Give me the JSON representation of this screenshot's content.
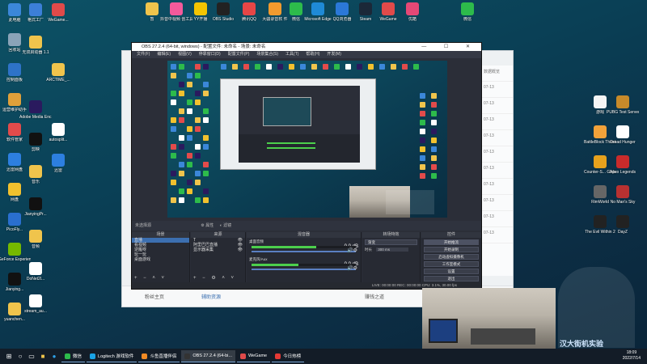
{
  "desktop": {
    "left_icons": [
      {
        "label": "此电脑",
        "icon": "computer-icon",
        "color": "#3b87d9"
      },
      {
        "label": "回收站",
        "icon": "recycle-bin-icon",
        "color": "#8aa3b8"
      },
      {
        "label": "控制面板",
        "icon": "control-panel-icon",
        "color": "#2e73c8"
      },
      {
        "label": "运营维护助手",
        "icon": "maintenance-icon",
        "color": "#e0a03a"
      },
      {
        "label": "软件管家",
        "icon": "software-manager-icon",
        "color": "#e24b4b"
      },
      {
        "label": "迅雷网盘",
        "icon": "thunder-drive-icon",
        "color": "#2d7fe0"
      },
      {
        "label": "网盘",
        "icon": "netdisk-icon",
        "color": "#f2c12e"
      },
      {
        "label": "PicoFly...",
        "icon": "picofly-icon",
        "color": "#2a6fcf"
      },
      {
        "label": "GeForce Experience",
        "icon": "geforce-icon",
        "color": "#76b900"
      },
      {
        "label": "Jianying...",
        "icon": "jianying-icon",
        "color": "#111111"
      },
      {
        "label": "yuanchen...",
        "icon": "folder-icon",
        "color": "#f0c44c"
      }
    ],
    "col2_icons": [
      {
        "label": "格式工厂",
        "icon": "format-factory-icon",
        "color": "#3c7fd8"
      },
      {
        "label": "无双启动器 1.1",
        "icon": "launcher-icon",
        "color": "#f0c44c"
      },
      {
        "label": "Adobe Media Enc...",
        "icon": "adobe-media-encoder-icon",
        "color": "#2a1a5e"
      },
      {
        "label": "剪映",
        "icon": "capcut-icon",
        "color": "#111111"
      },
      {
        "label": "音乐",
        "icon": "music-folder-icon",
        "color": "#f0c44c"
      },
      {
        "label": "JianyingPr...",
        "icon": "jianying-pro-icon",
        "color": "#111111"
      },
      {
        "label": "音频",
        "icon": "audio-folder-icon",
        "color": "#f0c44c"
      },
      {
        "label": "DoNet2l...",
        "icon": "document-icon",
        "color": "#ffffff"
      },
      {
        "label": "stream_au...",
        "icon": "document-icon",
        "color": "#ffffff"
      }
    ],
    "col3_icons": [
      {
        "label": "WeGame...",
        "icon": "wegame-icon",
        "color": "#e04a4a"
      },
      {
        "label": "ARCTIME_...",
        "icon": "arctime-icon",
        "color": "#f0c44c"
      },
      {
        "label": "autosplit...",
        "icon": "document-icon",
        "color": "#ffffff"
      },
      {
        "label": "迅雷",
        "icon": "thunder-icon",
        "color": "#2d7fe0"
      }
    ],
    "top_icons": [
      {
        "label": "暂",
        "icon": "file-icon",
        "color": "#f0c44c"
      },
      {
        "label": "抖音中视频 创工具",
        "icon": "douyin-icon",
        "color": "#f45a9b"
      },
      {
        "label": "YY开播",
        "icon": "yy-icon",
        "color": "#f4c400"
      },
      {
        "label": "OBS Studio",
        "icon": "obs-icon",
        "color": "#222222"
      },
      {
        "label": "腾讯QQ",
        "icon": "qq-icon",
        "color": "#e64646"
      },
      {
        "label": "大疆录音软 件",
        "icon": "dji-icon",
        "color": "#f39a2e"
      },
      {
        "label": "微信",
        "icon": "wechat-icon",
        "color": "#2dbb4b"
      },
      {
        "label": "Microsoft Edge",
        "icon": "edge-icon",
        "color": "#1f8ad6"
      },
      {
        "label": "QQ浏览器",
        "icon": "qq-browser-icon",
        "color": "#2b78d8"
      },
      {
        "label": "Steam",
        "icon": "steam-icon",
        "color": "#1b2838"
      },
      {
        "label": "WeGame",
        "icon": "wegame-icon",
        "color": "#e04a4a"
      },
      {
        "label": "优酷",
        "icon": "youku-icon",
        "color": "#e54876"
      },
      {
        "label": "微信",
        "icon": "wechat-icon",
        "color": "#2dbb4b"
      }
    ],
    "right_icons": [
      {
        "label": "游戏",
        "icon": "game-icon",
        "color": "#f5f5f5"
      },
      {
        "label": "PUBG Test Server",
        "icon": "pubg-icon",
        "color": "#c78a2a"
      },
      {
        "label": "BattleBlock Theater",
        "icon": "battleblock-icon",
        "color": "#f2a23a"
      },
      {
        "label": "Dread Hunger",
        "icon": "dread-hunger-icon",
        "color": "#ffffff"
      },
      {
        "label": "Counter-S... Global Off...",
        "icon": "csgo-icon",
        "color": "#e7a21d"
      },
      {
        "label": "Apex Legends",
        "icon": "apex-icon",
        "color": "#c92b2b"
      },
      {
        "label": "RimWorld",
        "icon": "rimworld-icon",
        "color": "#666666"
      },
      {
        "label": "No Man's Sky",
        "icon": "no-mans-sky-icon",
        "color": "#b83131"
      },
      {
        "label": "The Evil Within 2",
        "icon": "evil-within-icon",
        "color": "#222222"
      },
      {
        "label": "DayZ",
        "icon": "dayz-icon",
        "color": "#222222"
      }
    ]
  },
  "background_window": {
    "right_header": "数据概览",
    "right_rows": [
      "07-13",
      "07-13",
      "07-13",
      "07-13",
      "07-13",
      "07-13",
      "07-13",
      "07-13",
      "07-13",
      "07-13"
    ],
    "footer_left": "粉丝主页",
    "footer_link": "辅助资源",
    "footer_right": "赚钱之道"
  },
  "obs": {
    "title": "OBS 27.2.4 (64-bit, windows) - 配置文件: 未命名 - 场景: 未命名",
    "window_buttons": "—  ☐  ✕",
    "menu": [
      "文件(F)",
      "编辑(E)",
      "视图(V)",
      "停靠窗口(D)",
      "配置文件(P)",
      "场景集合(S)",
      "工具(T)",
      "帮助(H)",
      "开发(M)"
    ],
    "scene_bar": "未选择源",
    "scene_bar_props": "属性",
    "scene_bar_filters": "滤镜",
    "scenes_header": "场景",
    "scenes": [
      "直播",
      "看视频",
      "逆雁呀",
      "玩一玩",
      "桌面游戏"
    ],
    "sources_header": "来源",
    "sources": [
      "T",
      "阿里巴巴直播",
      "显示器采集"
    ],
    "mixer_header": "混音器",
    "mixer_tracks": [
      {
        "name": "桌面音频",
        "level": "0.0 dB",
        "fill": 0.62
      },
      {
        "name": "麦克风/Aux",
        "level": "0.0 dB",
        "fill": 0.45
      }
    ],
    "transitions_header": "转场特效",
    "transition_value": "渐变",
    "duration_label": "时长",
    "duration_value": "300 ms",
    "controls_header": "控件",
    "controls": [
      "开始推流",
      "开始录制",
      "启动虚拟摄像机",
      "工作室模式",
      "设置",
      "退出"
    ],
    "status": "LIVE: 00:00:00   REC: 00:00:00   CPU: 3.1%, 30.00 fps"
  },
  "taskbar": {
    "tasks": [
      {
        "label": "微信",
        "color": "#2dbb4b",
        "active": false
      },
      {
        "label": "Logitech 游戏软件",
        "color": "#19a3e6",
        "active": false
      },
      {
        "label": "斗鱼直播伴侣",
        "color": "#f08a24",
        "active": false
      },
      {
        "label": "OBS 27.2.4 (64-bi...",
        "color": "#333333",
        "active": true
      },
      {
        "label": "WeGame",
        "color": "#e04a4a",
        "active": false
      },
      {
        "label": "今日热榜",
        "color": "#e53935",
        "active": false
      }
    ],
    "time": "18:09",
    "date": "2022/7/14"
  },
  "overlay_text": "汉大街机实验"
}
